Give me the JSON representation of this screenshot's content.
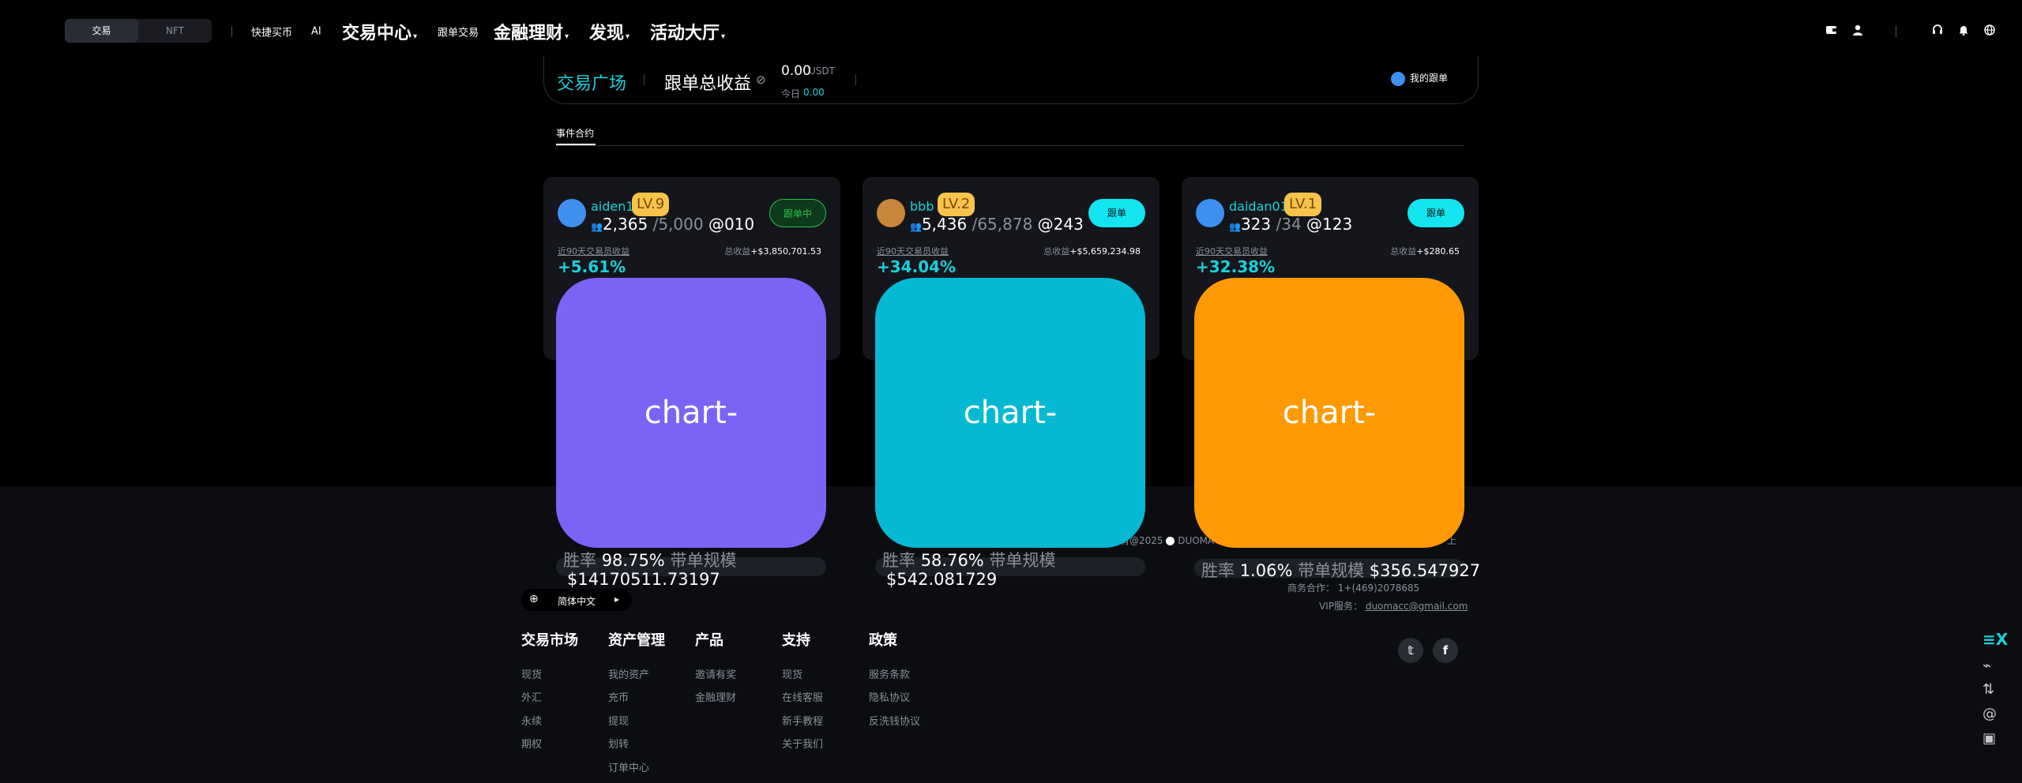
{
  "nav": {
    "segments": [
      "交易",
      "NFT"
    ],
    "links": [
      {
        "label": "快捷买币",
        "size": "small"
      },
      {
        "label": "AI",
        "size": "small"
      },
      {
        "label": "交易中心",
        "size": "big",
        "caret": true
      },
      {
        "label": "跟单交易",
        "size": "small"
      },
      {
        "label": "金融理财",
        "size": "big",
        "caret": true
      },
      {
        "label": "发现",
        "size": "big",
        "caret": true
      },
      {
        "label": "活动大厅",
        "size": "big",
        "caret": true
      }
    ],
    "icons": [
      "wallet-icon",
      "user-icon",
      "headset-icon",
      "bell-icon",
      "globe-icon"
    ]
  },
  "header_bar": {
    "plaza": "交易广场",
    "total_label": "跟单总收益",
    "total_value": "0.00",
    "unit": "USDT",
    "today_label": "今日",
    "today_value": "0.00",
    "my_follow": "我的跟单"
  },
  "tab": {
    "label": "事件合约"
  },
  "traders": [
    {
      "name": "aiden1",
      "level": "LV.9",
      "followers": "2,365",
      "max": "/5,000",
      "at": "@010",
      "button": "跟单中",
      "button_state": "active",
      "label_90d": "近90天交易员收益",
      "total_label": "总收益",
      "total": "+$3,850,701.53",
      "pct": "+5.61%",
      "chart": "chart-",
      "chart_color": "#7b63f6",
      "win_label": "胜率",
      "win": "98.75%",
      "scale_label": "带单规模",
      "scale": "$14170511.73197",
      "avatar_color": "#3f8ff0"
    },
    {
      "name": "bbb",
      "level": "LV.2",
      "followers": "5,436",
      "max": "/65,878",
      "at": "@243",
      "button": "跟单",
      "button_state": "normal",
      "label_90d": "近90天交易员收益",
      "total_label": "总收益",
      "total": "+$5,659,234.98",
      "pct": "+34.04%",
      "chart": "chart-",
      "chart_color": "#06b9d3",
      "win_label": "胜率",
      "win": "58.76%",
      "scale_label": "带单规模",
      "scale": "$542.081729",
      "avatar_color": "#c8873a"
    },
    {
      "name": "daidan01",
      "level": "LV.1",
      "followers": "323",
      "max": "/34",
      "at": "@123",
      "button": "跟单",
      "button_state": "normal",
      "label_90d": "近90天交易员收益",
      "total_label": "总收益",
      "total": "+$280.65",
      "pct": "+32.38%",
      "chart": "chart-",
      "chart_color": "#ff9a05",
      "win_label": "胜率",
      "win": "1.06%",
      "scale_label": "带单规模",
      "scale": "$356.547927",
      "avatar_color": "#3f8ff0"
    }
  ],
  "footer": {
    "copyright_partial": "有@2025",
    "brand_partial": "DUOMA",
    "right_partial": "上",
    "language": "简体中文",
    "business_label": "商务合作：",
    "business_value": "1+(469)2078685",
    "vip_label": "VIP服务：",
    "vip_value": "duomacc@gmail.com",
    "columns": [
      {
        "title": "交易市场",
        "items": [
          "现货",
          "外汇",
          "永续",
          "期权"
        ]
      },
      {
        "title": "资产管理",
        "items": [
          "我的资产",
          "充币",
          "提现",
          "划转",
          "订单中心"
        ]
      },
      {
        "title": "产品",
        "items": [
          "邀请有奖",
          "金融理财"
        ]
      },
      {
        "title": "支持",
        "items": [
          "现货",
          "在线客服",
          "新手教程",
          "关于我们"
        ]
      },
      {
        "title": "政策",
        "items": [
          "服务条款",
          "隐私协议",
          "反洗钱协议"
        ]
      }
    ],
    "social": [
      "twitter-icon",
      "facebook-icon"
    ]
  },
  "side_icons": [
    "exchange-logo-icon",
    "pulse-icon",
    "swap-icon",
    "at-icon",
    "wallet-small-icon"
  ],
  "colors": {
    "accent": "#1ad0db",
    "gold": "#f7c34a",
    "active_green": "#2fbf4b"
  }
}
